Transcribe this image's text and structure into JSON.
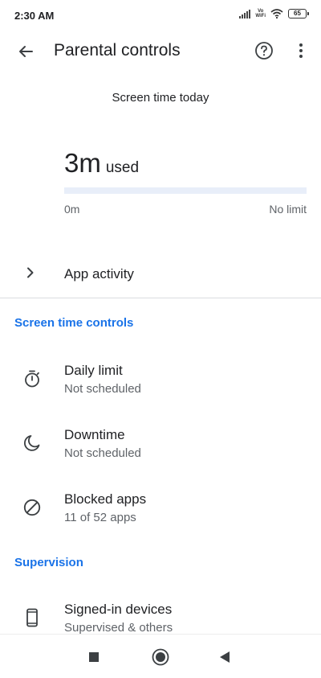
{
  "status_bar": {
    "time": "2:30 AM",
    "vo": "Vo",
    "wifi_label": "WiFi",
    "battery": "65"
  },
  "app_bar": {
    "title": "Parental controls",
    "icons": [
      "arrow-back-icon",
      "help-circle-icon",
      "more-vert-icon"
    ]
  },
  "screen_time": {
    "label": "Screen time today",
    "used_value": "3m",
    "used_unit": "used",
    "progress_fraction": 0.0,
    "range_min": "0m",
    "range_max": "No limit"
  },
  "app_activity": {
    "label": "App activity"
  },
  "screen_time_controls": {
    "header": "Screen time controls",
    "items": [
      {
        "title": "Daily limit",
        "subtitle": "Not scheduled",
        "icon": "timer-icon"
      },
      {
        "title": "Downtime",
        "subtitle": "Not scheduled",
        "icon": "moon-icon"
      },
      {
        "title": "Blocked apps",
        "subtitle": "11 of 52 apps",
        "icon": "block-icon"
      }
    ]
  },
  "supervision": {
    "header": "Supervision",
    "items": [
      {
        "title": "Signed-in devices",
        "subtitle": "Supervised & others",
        "icon": "phone-icon"
      }
    ]
  },
  "colors": {
    "accent": "#1a73e8",
    "progress_track": "#e8eef9",
    "text_primary": "#202124",
    "text_secondary": "#5f6368"
  }
}
